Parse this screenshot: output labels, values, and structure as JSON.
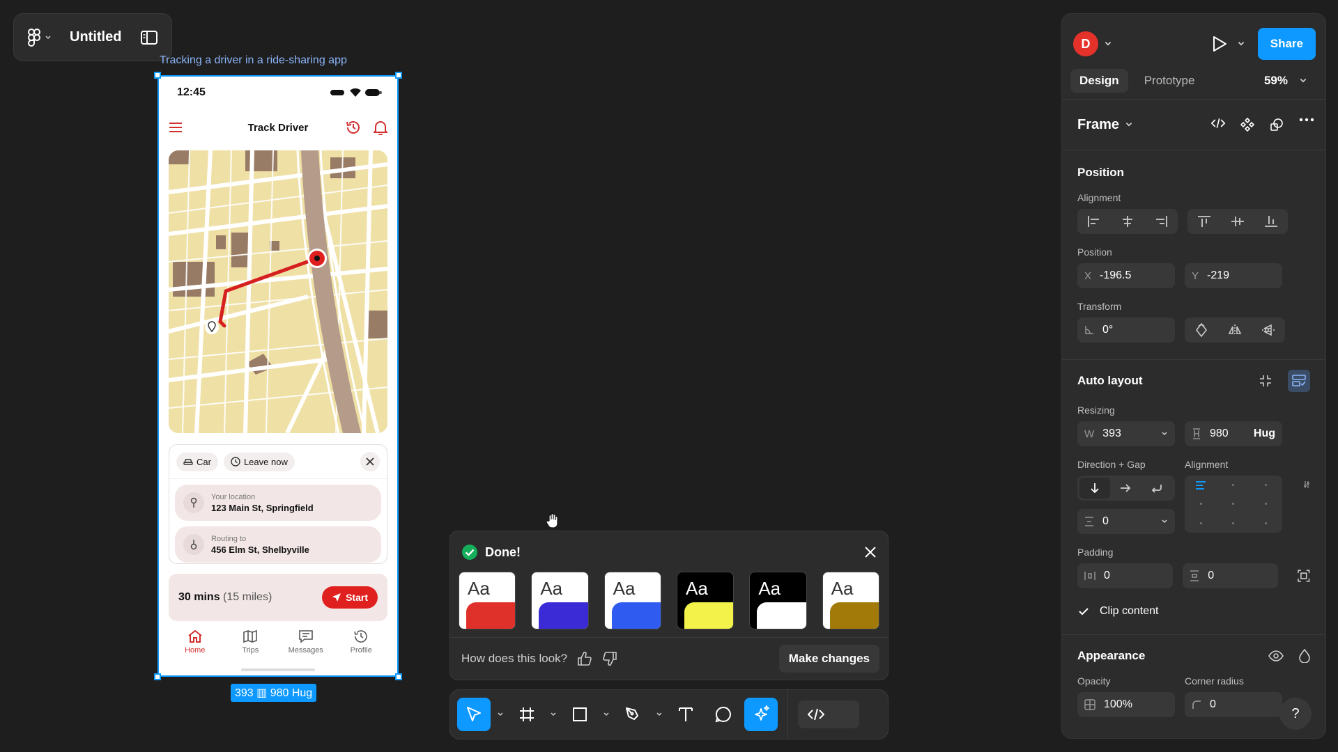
{
  "file": {
    "title": "Untitled"
  },
  "frame_label": "Tracking a driver in a ride-sharing app",
  "size_tag": "393 ▥ 980 Hug",
  "phone": {
    "time": "12:45",
    "title": "Track Driver",
    "chips": {
      "mode": "Car",
      "depart": "Leave now"
    },
    "origin": {
      "label": "Your location",
      "address": "123 Main St, Springfield"
    },
    "destination": {
      "label": "Routing to",
      "address": "456 Elm St, Shelbyville"
    },
    "eta": {
      "time": "30 mins",
      "distance": "(15 miles)"
    },
    "start_label": "Start",
    "tabs": [
      {
        "label": "Home",
        "icon": "home-icon"
      },
      {
        "label": "Trips",
        "icon": "map-icon"
      },
      {
        "label": "Messages",
        "icon": "message-icon"
      },
      {
        "label": "Profile",
        "icon": "history-icon"
      }
    ],
    "colors": {
      "accent": "#e0201e"
    }
  },
  "ai_dialog": {
    "status": "Done!",
    "swatch_text": "Aa",
    "swatches": [
      {
        "bg": "#ffffff",
        "fg": "#333333",
        "bar": "#e0302a"
      },
      {
        "bg": "#ffffff",
        "fg": "#333333",
        "bar": "#3a2bd6"
      },
      {
        "bg": "#ffffff",
        "fg": "#333333",
        "bar": "#2f5bf0"
      },
      {
        "bg": "#000000",
        "fg": "#ffffff",
        "bar": "#f2f24a"
      },
      {
        "bg": "#000000",
        "fg": "#ffffff",
        "bar": "#ffffff"
      },
      {
        "bg": "#ffffff",
        "fg": "#333333",
        "bar": "#a27a0a"
      }
    ],
    "question": "How does this look?",
    "make_changes": "Make changes"
  },
  "panel": {
    "avatar": "D",
    "share": "Share",
    "tabs": [
      "Design",
      "Prototype"
    ],
    "zoom": "59%",
    "frame": "Frame",
    "position": {
      "title": "Position",
      "alignment_label": "Alignment",
      "position_label": "Position",
      "x_label": "X",
      "x": "-196.5",
      "y_label": "Y",
      "y": "-219",
      "transform_label": "Transform",
      "rotation": "0°"
    },
    "auto_layout": {
      "title": "Auto layout",
      "resizing_label": "Resizing",
      "w_label": "W",
      "w": "393",
      "h_label": "H",
      "h": "980",
      "h_mode": "Hug",
      "direction_label": "Direction + Gap",
      "alignment_label": "Alignment",
      "gap": "0",
      "padding_label": "Padding",
      "padding_h": "0",
      "padding_v": "0",
      "clip_label": "Clip content"
    },
    "appearance": {
      "title": "Appearance",
      "opacity_label": "Opacity",
      "opacity": "100%",
      "radius_label": "Corner radius",
      "radius": "0"
    },
    "help": "?"
  }
}
